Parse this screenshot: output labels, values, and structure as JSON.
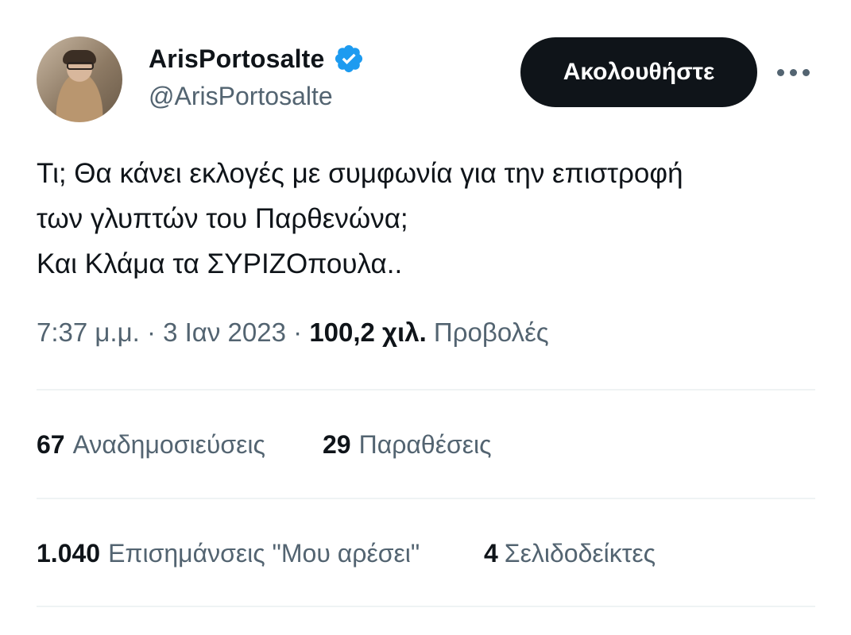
{
  "author": {
    "display_name": "ArisPortosalte",
    "handle": "@ArisPortosalte",
    "verified": true
  },
  "follow_label": "Ακολουθήστε",
  "tweet": {
    "lines": [
      "Τι; Θα κάνει εκλογές με συμφωνία για την επιστροφή",
      "των γλυπτών του Παρθενώνα;",
      "Και Κλάμα τα ΣΥΡΙΖΟπουλα.."
    ]
  },
  "meta": {
    "time": "7:37 μ.μ.",
    "sep1": "·",
    "date": "3 Ιαν 2023",
    "sep2": "·",
    "views_count": "100,2 χιλ.",
    "views_label": "Προβολές"
  },
  "stats": {
    "reposts_count": "67",
    "reposts_label": "Αναδημοσιεύσεις",
    "quotes_count": "29",
    "quotes_label": "Παραθέσεις",
    "likes_count": "1.040",
    "likes_label": "Επισημάνσεις \"Μου αρέσει\"",
    "bookmarks_count": "4",
    "bookmarks_label": "Σελιδοδείκτες"
  },
  "colors": {
    "verified_blue": "#1d9bf0",
    "text_primary": "#0f1419",
    "text_secondary": "#536471",
    "divider": "#eff3f4"
  },
  "icons": {
    "verified": "verified-badge-icon",
    "more": "more-horizontal-icon"
  }
}
